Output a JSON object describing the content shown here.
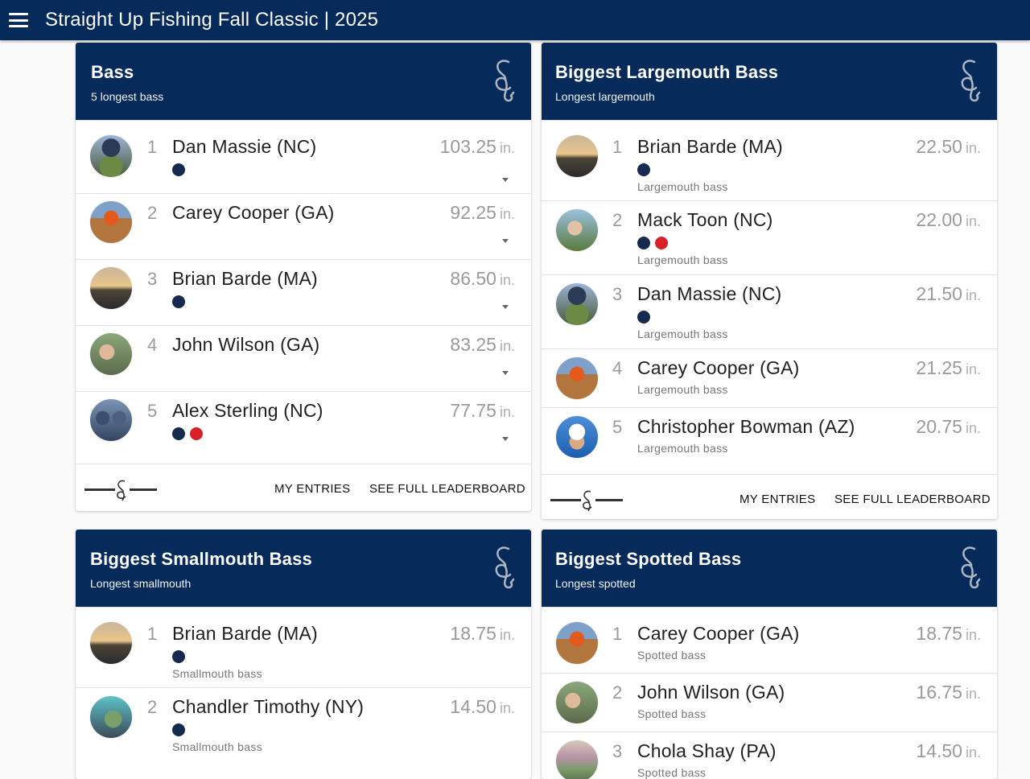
{
  "app": {
    "title": "Straight Up Fishing Fall Classic | 2025"
  },
  "footer": {
    "my_entries": "MY ENTRIES",
    "full_leaderboard": "SEE FULL LEADERBOARD"
  },
  "units": "in.",
  "icons": {
    "menu": "hamburger-menu-icon",
    "header_logo": "fishing-chaos-emblem-icon",
    "badge_member": "fishing-chaos-badge-icon",
    "badge_lips": "lips-badge-icon",
    "expand": "caret-down-icon"
  },
  "colors": {
    "navy": "#062a5a",
    "lips_red": "#d6232a",
    "muted": "#9a9a9a"
  },
  "cards": [
    {
      "title": "Bass",
      "subtitle": "5 longest bass",
      "entries": [
        {
          "rank": "1",
          "name": "Dan Massie (NC)",
          "score": "103.25",
          "category": "",
          "badges": [
            "logo"
          ]
        },
        {
          "rank": "2",
          "name": "Carey Cooper (GA)",
          "score": "92.25",
          "category": "",
          "badges": []
        },
        {
          "rank": "3",
          "name": "Brian Barde (MA)",
          "score": "86.50",
          "category": "",
          "badges": [
            "logo"
          ]
        },
        {
          "rank": "4",
          "name": "John Wilson (GA)",
          "score": "83.25",
          "category": "",
          "badges": []
        },
        {
          "rank": "5",
          "name": "Alex Sterling (NC)",
          "score": "77.75",
          "category": "",
          "badges": [
            "logo",
            "lips"
          ]
        }
      ]
    },
    {
      "title": "Biggest Largemouth Bass",
      "subtitle": "Longest largemouth",
      "entries": [
        {
          "rank": "1",
          "name": "Brian Barde (MA)",
          "score": "22.50",
          "category": "Largemouth bass",
          "badges": [
            "logo"
          ]
        },
        {
          "rank": "2",
          "name": "Mack Toon (NC)",
          "score": "22.00",
          "category": "Largemouth bass",
          "badges": [
            "logo",
            "lips"
          ]
        },
        {
          "rank": "3",
          "name": "Dan Massie (NC)",
          "score": "21.50",
          "category": "Largemouth bass",
          "badges": [
            "logo"
          ]
        },
        {
          "rank": "4",
          "name": "Carey Cooper (GA)",
          "score": "21.25",
          "category": "Largemouth bass",
          "badges": []
        },
        {
          "rank": "5",
          "name": "Christopher Bowman (AZ)",
          "score": "20.75",
          "category": "Largemouth bass",
          "badges": []
        }
      ]
    },
    {
      "title": "Biggest Smallmouth Bass",
      "subtitle": "Longest smallmouth",
      "entries": [
        {
          "rank": "1",
          "name": "Brian Barde (MA)",
          "score": "18.75",
          "category": "Smallmouth bass",
          "badges": [
            "logo"
          ]
        },
        {
          "rank": "2",
          "name": "Chandler Timothy (NY)",
          "score": "14.50",
          "category": "Smallmouth bass",
          "badges": [
            "logo"
          ]
        }
      ]
    },
    {
      "title": "Biggest Spotted Bass",
      "subtitle": "Longest spotted",
      "entries": [
        {
          "rank": "1",
          "name": "Carey Cooper (GA)",
          "score": "18.75",
          "category": "Spotted bass",
          "badges": []
        },
        {
          "rank": "2",
          "name": "John Wilson (GA)",
          "score": "16.75",
          "category": "Spotted bass",
          "badges": []
        },
        {
          "rank": "3",
          "name": "Chola Shay (PA)",
          "score": "14.50",
          "category": "Spotted bass",
          "badges": []
        }
      ]
    }
  ]
}
